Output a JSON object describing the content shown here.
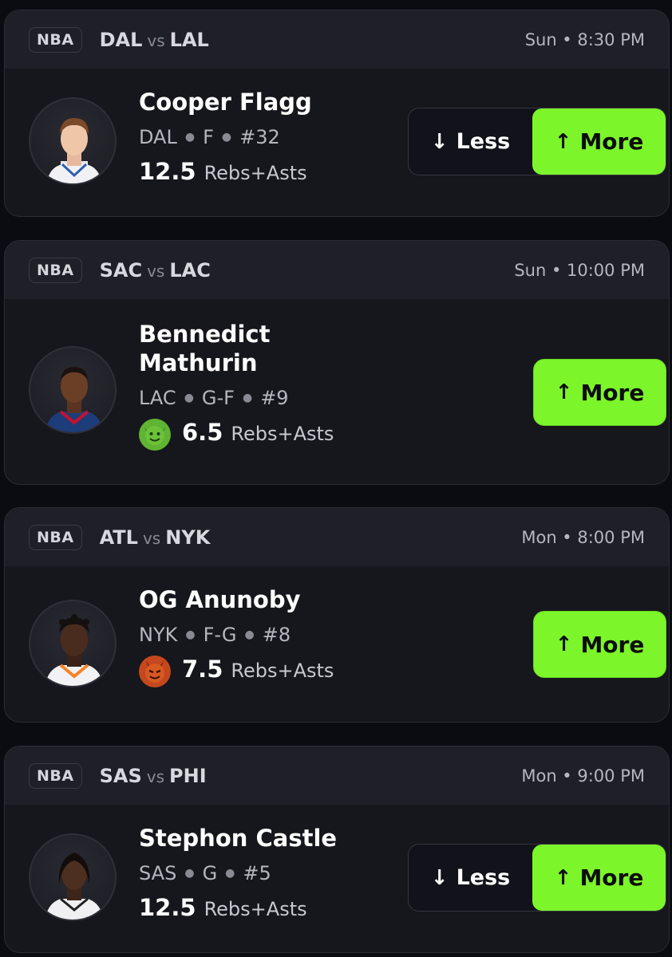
{
  "colors": {
    "accent": "#7cf52a",
    "background": "#0b0b12",
    "card": "#16161d",
    "header": "#1f1f27"
  },
  "cards": [
    {
      "league": "NBA",
      "team1": "DAL",
      "vs": "vs",
      "team2": "LAL",
      "time": "Sun • 8:30 PM",
      "player_name": "Cooper Flagg",
      "team": "DAL",
      "position": "F",
      "number": "#32",
      "line_value": "12.5",
      "stat_type": "Rebs+Asts",
      "less_label": "Less",
      "more_label": "More"
    },
    {
      "league": "NBA",
      "team1": "SAC",
      "vs": "vs",
      "team2": "LAC",
      "time": "Sun • 10:00 PM",
      "player_name": "Bennedict Mathurin",
      "team": "LAC",
      "position": "G-F",
      "number": "#9",
      "badge_icon": "goblin-icon",
      "line_value": "6.5",
      "stat_type": "Rebs+Asts",
      "more_label": "More"
    },
    {
      "league": "NBA",
      "team1": "ATL",
      "vs": "vs",
      "team2": "NYK",
      "time": "Mon • 8:00 PM",
      "player_name": "OG Anunoby",
      "team": "NYK",
      "position": "F-G",
      "number": "#8",
      "badge_icon": "demon-icon",
      "line_value": "7.5",
      "stat_type": "Rebs+Asts",
      "more_label": "More"
    },
    {
      "league": "NBA",
      "team1": "SAS",
      "vs": "vs",
      "team2": "PHI",
      "time": "Mon • 9:00 PM",
      "player_name": "Stephon Castle",
      "team": "SAS",
      "position": "G",
      "number": "#5",
      "line_value": "12.5",
      "stat_type": "Rebs+Asts",
      "less_label": "Less",
      "more_label": "More"
    }
  ]
}
